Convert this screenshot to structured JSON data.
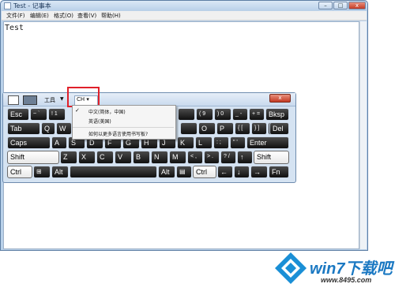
{
  "window": {
    "title": "Test - 记事本",
    "menu": [
      "文件(F)",
      "编辑(E)",
      "格式(O)",
      "查看(V)",
      "帮助(H)"
    ],
    "document_text": "Test"
  },
  "keyboard": {
    "toolbar": {
      "tools_label": "工具",
      "lang_label": "CH",
      "close_label": "x"
    },
    "rows": [
      [
        "Esc",
        "~ `",
        "! 1",
        "",
        "",
        "",
        "",
        "",
        "( 9",
        ") 0",
        "_ -",
        "+ =",
        "Bksp"
      ],
      [
        "Tab",
        "Q",
        "W",
        "",
        "",
        "",
        "",
        "",
        "",
        "O",
        "P",
        "{ [",
        "} ]",
        "| \\",
        "Del"
      ],
      [
        "Caps",
        "A",
        "S",
        "D",
        "F",
        "G",
        "H",
        "J",
        "K",
        "L",
        ": ;",
        "\" '",
        "Enter"
      ],
      [
        "Shift",
        "Z",
        "X",
        "C",
        "V",
        "B",
        "N",
        "M",
        "< ,",
        "> .",
        "? /",
        "↑",
        "Shift"
      ],
      [
        "Ctrl",
        "Win",
        "Alt",
        "",
        "Alt",
        "Menu",
        "Ctrl",
        "←",
        "↓",
        "→",
        "Fn"
      ]
    ],
    "language_menu": {
      "items": [
        "中文(简体，中国)",
        "英语(美国)",
        "如何以更多语言使用书写板?"
      ],
      "selected_index": 0
    }
  },
  "watermark": {
    "brand": "win7下载吧",
    "url": "www.8495.com"
  }
}
